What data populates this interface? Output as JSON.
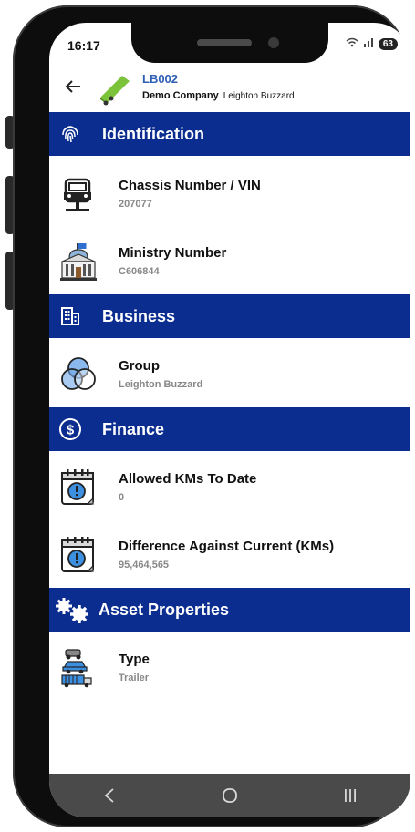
{
  "status": {
    "time": "16:17",
    "battery": "63"
  },
  "header": {
    "asset_code": "LB002",
    "company": "Demo Company",
    "location": "Leighton Buzzard"
  },
  "sections": {
    "identification": {
      "title": "Identification",
      "rows": [
        {
          "label": "Chassis Number / VIN",
          "value": "207077"
        },
        {
          "label": "Ministry Number",
          "value": "C606844"
        }
      ]
    },
    "business": {
      "title": "Business",
      "rows": [
        {
          "label": "Group",
          "value": "Leighton Buzzard"
        }
      ]
    },
    "finance": {
      "title": "Finance",
      "rows": [
        {
          "label": "Allowed KMs To Date",
          "value": "0"
        },
        {
          "label": "Difference Against Current (KMs)",
          "value": "95,464,565"
        }
      ]
    },
    "asset_properties": {
      "title": "Asset Properties",
      "rows": [
        {
          "label": "Type",
          "value": "Trailer"
        }
      ]
    }
  },
  "icons": {
    "back": "arrow-left-icon",
    "asset": "truck-trailer-icon",
    "identification": "fingerprint-icon",
    "business": "building-icon",
    "finance": "dollar-circle-icon",
    "asset_properties": "gears-icon"
  },
  "colors": {
    "section_bg": "#0b2d8f",
    "asset_code": "#2e5fb5",
    "navbar": "#4a4a4a"
  },
  "nav": {
    "back": "<",
    "home": "○",
    "recents": "|||"
  }
}
